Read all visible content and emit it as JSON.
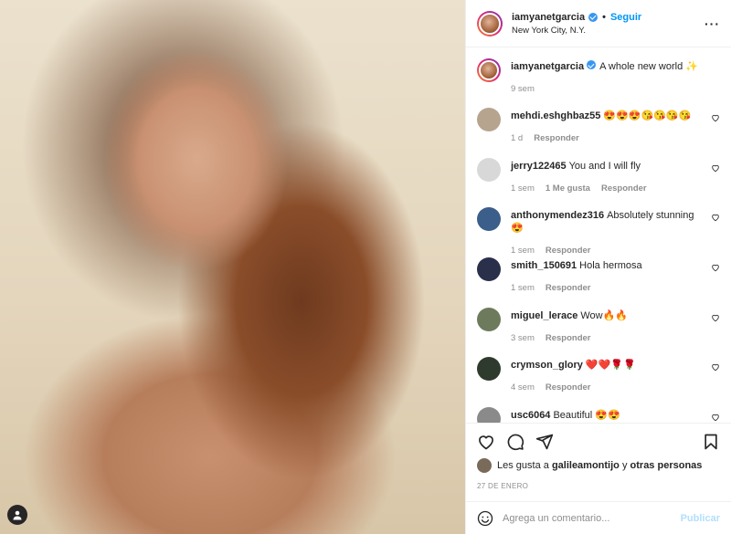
{
  "post": {
    "username": "iamyanetgarcia",
    "follow_label": "Seguir",
    "location": "New York City, N.Y.",
    "more_label": "···",
    "caption": "A whole new world ✨",
    "caption_time": "9 sem"
  },
  "comments": [
    {
      "user": "mehdi.eshghbaz55",
      "text": "😍😍😍😘😘😘😘",
      "time": "1 d",
      "likes": "",
      "reply": "Responder",
      "avatar_color": "#b7a48f"
    },
    {
      "user": "jerry122465",
      "text": "You and I will fly",
      "time": "1 sem",
      "likes": "1 Me gusta",
      "reply": "Responder",
      "avatar_color": "#d8d8d8"
    },
    {
      "user": "anthonymendez316",
      "text": "Absolutely stunning 😍",
      "time": "1 sem",
      "likes": "",
      "reply": "Responder",
      "avatar_color": "#3b5e8a"
    },
    {
      "user": "smith_150691",
      "text": "Hola hermosa",
      "time": "1 sem",
      "likes": "",
      "reply": "Responder",
      "avatar_color": "#2a2f4a"
    },
    {
      "user": "miguel_lerace",
      "text": "Wow🔥🔥",
      "time": "3 sem",
      "likes": "",
      "reply": "Responder",
      "avatar_color": "#6e7a5c"
    },
    {
      "user": "crymson_glory",
      "text": "❤️❤️🌹🌹",
      "time": "4 sem",
      "likes": "",
      "reply": "Responder",
      "avatar_color": "#2f3a2f"
    },
    {
      "user": "usc6064",
      "text": "Beautiful 😍😍",
      "time": "",
      "likes": "",
      "reply": "",
      "avatar_color": "#8a8a8a"
    }
  ],
  "likes": {
    "prefix": "Les gusta a",
    "first_user": "galileamontijo",
    "conjunction": "y",
    "others": "otras personas"
  },
  "date": "27 DE ENERO",
  "add_comment": {
    "placeholder": "Agrega un comentario...",
    "publish_label": "Publicar"
  },
  "icons": [
    "heart-icon",
    "comment-icon",
    "share-icon",
    "bookmark-icon",
    "emoji-icon",
    "user-tag-icon",
    "verified-icon"
  ]
}
